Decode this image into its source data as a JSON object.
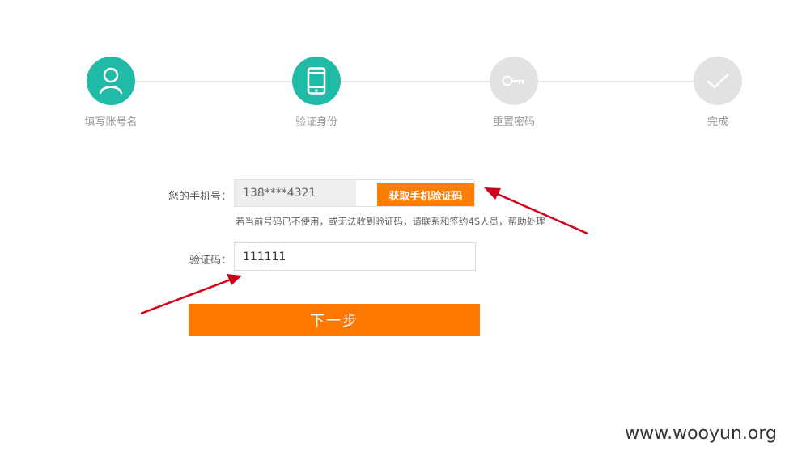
{
  "steps": [
    {
      "label": "填写账号名",
      "icon": "user-icon",
      "state": "active"
    },
    {
      "label": "验证身份",
      "icon": "phone-icon",
      "state": "active"
    },
    {
      "label": "重置密码",
      "icon": "key-icon",
      "state": "todo"
    },
    {
      "label": "完成",
      "icon": "check-icon",
      "state": "todo"
    }
  ],
  "form": {
    "phone_label": "您的手机号：",
    "phone_value": "138****4321",
    "get_code_button": "获取手机验证码",
    "hint": "若当前号码已不使用，或无法收到验证码，请联系和签约4S人员，帮助处理",
    "code_label": "验证码：",
    "code_value": "111111",
    "next_button": "下一步"
  },
  "watermark": "www.wooyun.org",
  "colors": {
    "accent_teal": "#1fbba6",
    "accent_orange": "#ff7800",
    "inactive_gray": "#e2e2e2",
    "annotation_red": "#d0021b"
  }
}
